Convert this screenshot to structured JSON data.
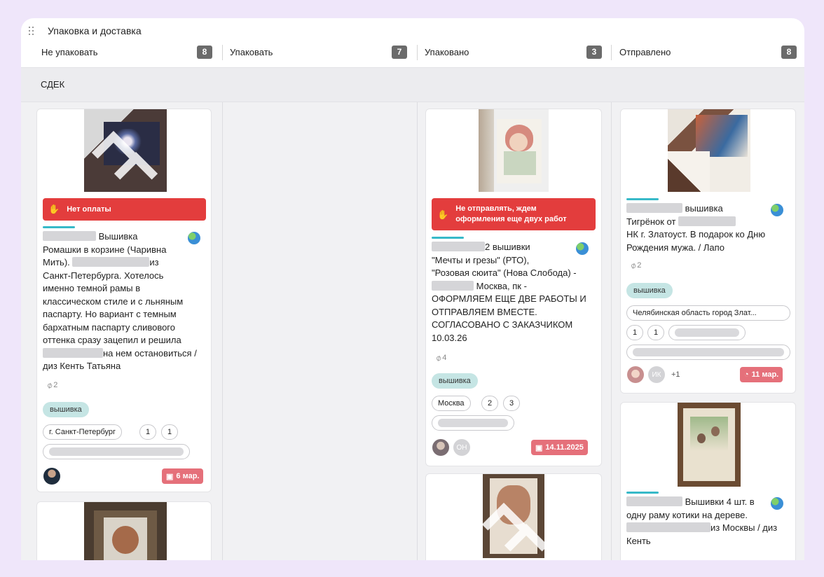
{
  "board": {
    "title": "Упаковка и доставка",
    "columns": [
      {
        "label": "Не упаковать",
        "count": "8"
      },
      {
        "label": "Упаковать",
        "count": "7"
      },
      {
        "label": "Упаковано",
        "count": "3"
      },
      {
        "label": "Отправлено",
        "count": "8"
      }
    ],
    "swimlane": "СДЕК"
  },
  "cards": {
    "c1": {
      "alert": "Нет оплаты",
      "text_1": "Вышивка",
      "text_2": "Ромашки в корзине (Чаривна",
      "text_3": "Мить).",
      "text_3b": "из",
      "text_4": "Санкт-Петербурга. Хотелось",
      "text_5": "именно темной рамы в",
      "text_6": "классическом стиле и с льняным",
      "text_7": "паспарту. Но вариант с темным",
      "text_8": "бархатным паспарту сливового",
      "text_9": "оттенка сразу зацепил и решила",
      "text_10": "на нем остановиться /",
      "text_11": "диз Кенть Татьяна",
      "attachments": "2",
      "tag": "вышивка",
      "chip_city": "г. Санкт-Петербург",
      "chip_a": "1",
      "chip_b": "1",
      "date": "6 мар."
    },
    "c3": {
      "alert_1": "Не отправлять, ждем",
      "alert_2": "оформления еще двух работ",
      "text_1": "2 вышивки",
      "text_2": "\"Мечты и грезы\" (РТО),",
      "text_3": "\"Розовая сюита\" (Нова Слобода) -",
      "text_4": "Москва, пк -",
      "text_5": "ОФОРМЛЯЕМ ЕЩЕ ДВЕ РАБОТЫ И",
      "text_6": "ОТПРАВЛЯЕМ ВМЕСТЕ.",
      "text_7": "СОГЛАСОВАНО С ЗАКАЗЧИКОМ",
      "text_8": "10.03.26",
      "attachments": "4",
      "tag": "вышивка",
      "chip_city": "Москва",
      "chip_a": "2",
      "chip_b": "3",
      "avatar_2": "ОН",
      "date": "14.11.2025"
    },
    "c4": {
      "text_1": "вышивка",
      "text_2": "Тигрёнок от",
      "text_3": "НК г. Златоуст. В подарок ко Дню",
      "text_4": "Рождения мужа. / Лапо",
      "attachments": "2",
      "tag": "вышивка",
      "chip_region": "Челябинская область город Злат...",
      "chip_a": "1",
      "chip_b": "1",
      "avatar_2": "ИК",
      "more": "+1",
      "date": "11 мар."
    },
    "c5": {
      "text_1": "Вышивки 4 шт. в",
      "text_2": "одну раму котики на дереве.",
      "text_3": "из Москвы / диз",
      "text_4": "Кенть"
    }
  },
  "colors": {
    "alert": "#e33d3d",
    "date_badge": "#e5707a",
    "tag": "#c5e5e4",
    "accent_line": "#37b9c8",
    "count_badge": "#6b6b6b"
  }
}
